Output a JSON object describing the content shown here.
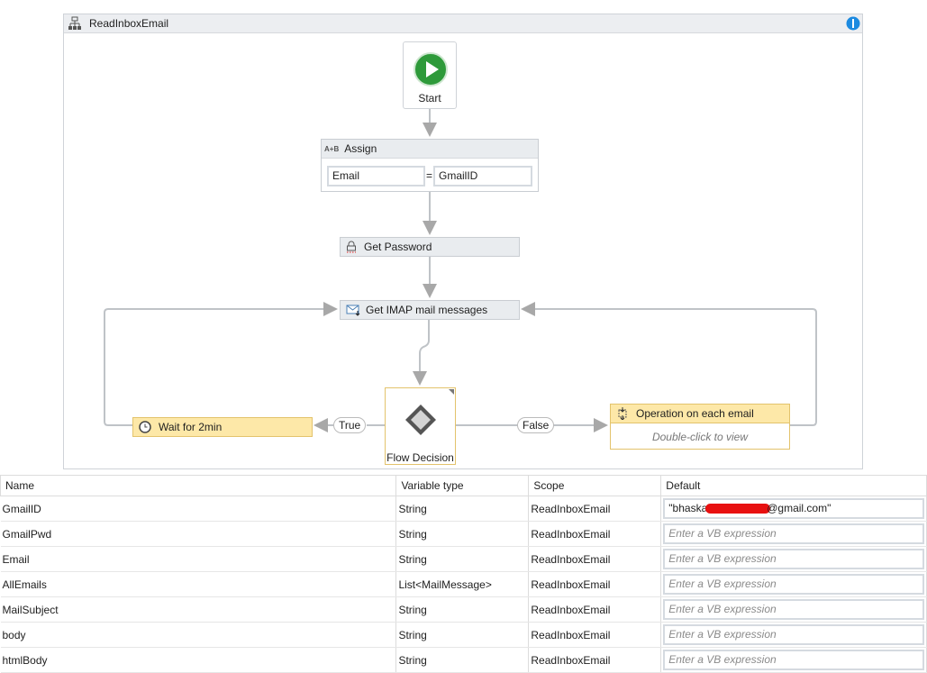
{
  "workflow": {
    "title": "ReadInboxEmail"
  },
  "nodes": {
    "start": "Start",
    "assign": {
      "title": "Assign",
      "to": "Email",
      "equals": "=",
      "value": "GmailID"
    },
    "get_password": "Get Password",
    "get_imap": "Get IMAP mail messages",
    "decision": "Flow Decision",
    "true_label": "True",
    "false_label": "False",
    "wait": "Wait for 2min",
    "operation": {
      "title": "Operation on each email",
      "hint": "Double-click to view"
    }
  },
  "variables": {
    "headers": [
      "Name",
      "Variable type",
      "Scope",
      "Default"
    ],
    "placeholder": "Enter a VB expression",
    "rows": [
      {
        "name": "GmailID",
        "type": "String",
        "scope": "ReadInboxEmail",
        "default_prefix": "\"bhaskar",
        "default_suffix": "@gmail.com\""
      },
      {
        "name": "GmailPwd",
        "type": "String",
        "scope": "ReadInboxEmail"
      },
      {
        "name": "Email",
        "type": "String",
        "scope": "ReadInboxEmail"
      },
      {
        "name": "AllEmails",
        "type": "List<MailMessage>",
        "scope": "ReadInboxEmail"
      },
      {
        "name": "MailSubject",
        "type": "String",
        "scope": "ReadInboxEmail"
      },
      {
        "name": "body",
        "type": "String",
        "scope": "ReadInboxEmail"
      },
      {
        "name": "htmlBody",
        "type": "String",
        "scope": "ReadInboxEmail"
      }
    ]
  },
  "colors": {
    "start_green": "#2e9a3a",
    "activity_yellow": "#fde8a8",
    "info_blue": "#1c8ae0",
    "redaction": "#e81010"
  }
}
